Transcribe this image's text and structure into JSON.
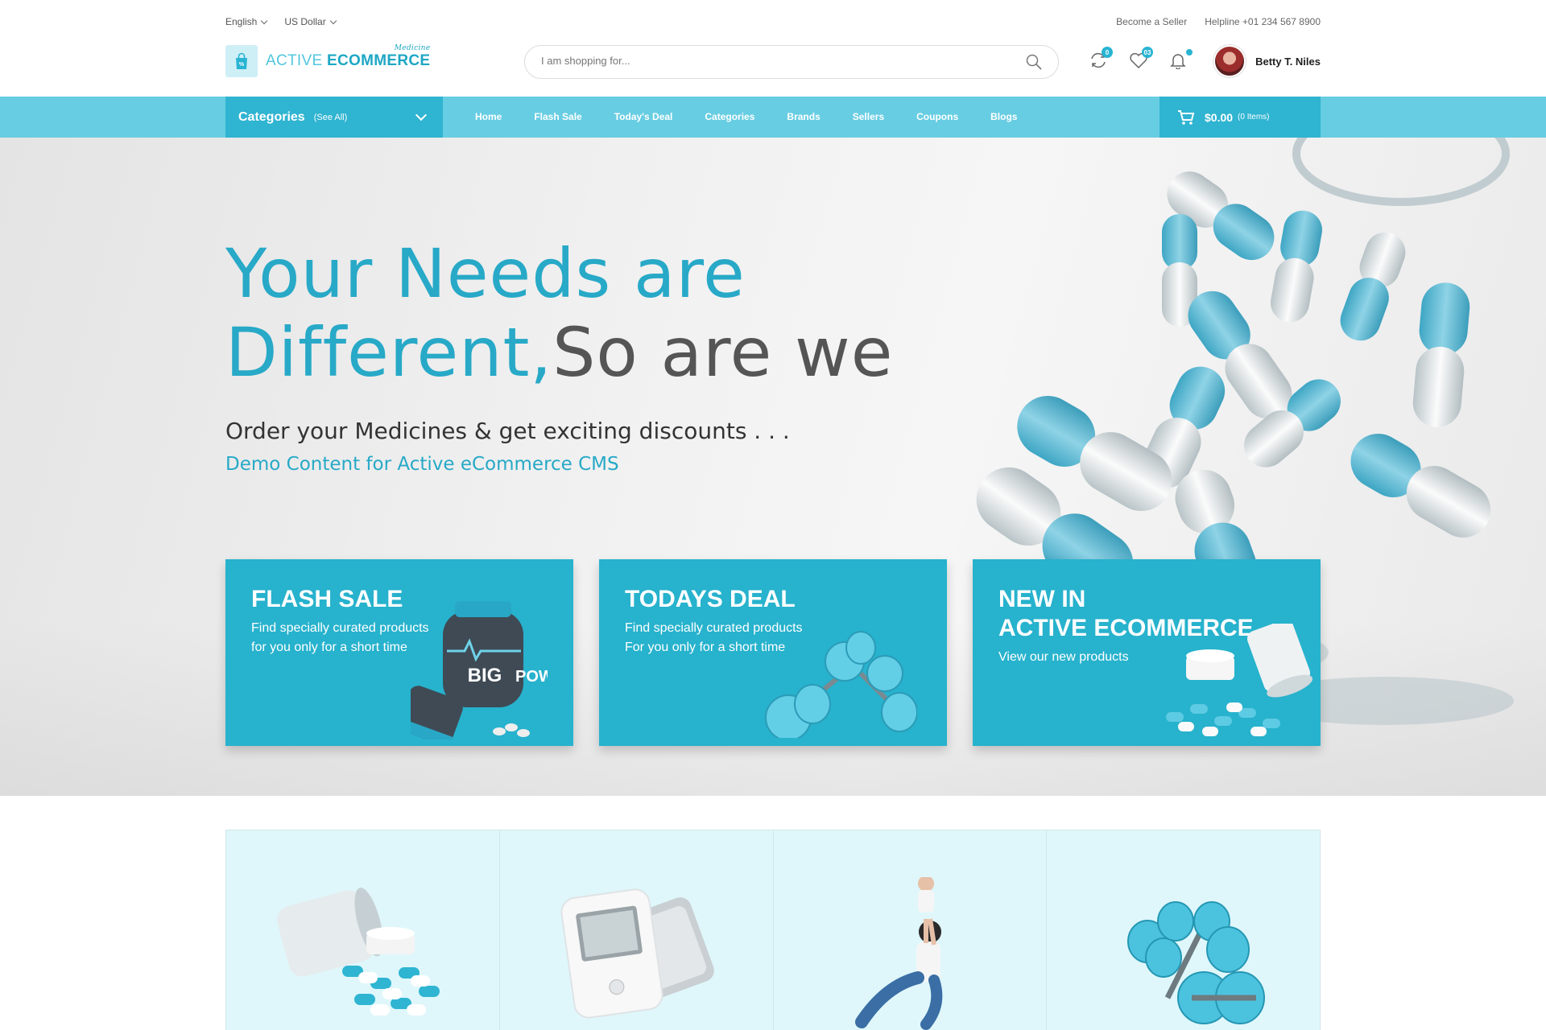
{
  "topbar": {
    "language": "English",
    "currency": "US Dollar",
    "become_seller": "Become a Seller",
    "helpline": "Helpline +01 234 567 8900"
  },
  "header": {
    "logo": {
      "part1": "ACTIVE",
      "part2": "ECOMMERCE",
      "tagline": "Medicine"
    },
    "search_placeholder": "I am shopping for...",
    "compare_count": "0",
    "wishlist_count": "03",
    "user_name": "Betty T. Niles"
  },
  "nav": {
    "categories_label": "Categories",
    "see_all": "(See All)",
    "links": [
      "Home",
      "Flash Sale",
      "Today's Deal",
      "Categories",
      "Brands",
      "Sellers",
      "Coupons",
      "Blogs"
    ],
    "cart_amount": "$0.00",
    "cart_items": "(0 Items)"
  },
  "hero": {
    "line1": "Your Needs are",
    "line2_accent": "Different,",
    "line2_dark": "So are we",
    "subtitle": "Order your Medicines & get exciting discounts . . .",
    "demo_note": "Demo Content for Active eCommerce CMS",
    "promos": [
      {
        "title": "FLASH SALE",
        "desc1": "Find specially curated products",
        "desc2": "for you only for a short time",
        "art_text1": "BIG",
        "art_text2": "POWER"
      },
      {
        "title": "TODAYS DEAL",
        "desc1": "Find specially curated products",
        "desc2": "For you only for a short time"
      },
      {
        "title1": "NEW IN",
        "title2": "ACTIVE ECOMMERCE",
        "desc1": "View our new products"
      }
    ]
  },
  "categories_row": [
    "pills-bottle-icon",
    "blood-pressure-monitor-icon",
    "mother-baby-icon",
    "dumbbells-icon"
  ],
  "colors": {
    "brand": "#27b2cd",
    "nav_bg": "#67cde2",
    "nav_dark": "#2fb4d1",
    "cat_bg": "#dff7fb"
  }
}
